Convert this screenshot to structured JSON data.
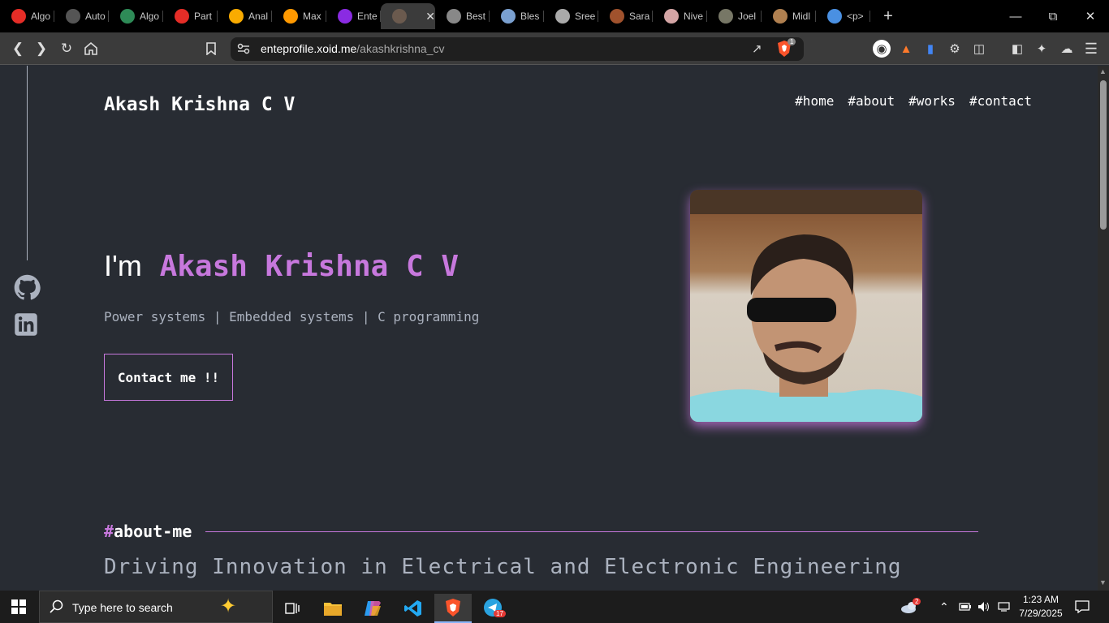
{
  "browser": {
    "tabs": [
      {
        "label": "Algo",
        "icon": "youtube-icon",
        "color": "#e52d27"
      },
      {
        "label": "Auto",
        "icon": "circle-logo-icon",
        "color": "#555555"
      },
      {
        "label": "Algo",
        "icon": "green-logo-icon",
        "color": "#2e8b57"
      },
      {
        "label": "Part",
        "icon": "youtube-icon",
        "color": "#e52d27"
      },
      {
        "label": "Anal",
        "icon": "analytics-icon",
        "color": "#f9ab00"
      },
      {
        "label": "Max",
        "icon": "amazon-icon",
        "color": "#ff9900"
      },
      {
        "label": "Ente",
        "icon": "ente-icon",
        "color": "#8a2be2"
      },
      {
        "label": "",
        "icon": "profile-photo-icon",
        "color": "#6b5a4e",
        "active": true
      },
      {
        "label": "Best",
        "icon": "photo-icon",
        "color": "#888888"
      },
      {
        "label": "Bles",
        "icon": "photo-icon",
        "color": "#7aa0d0"
      },
      {
        "label": "Sree",
        "icon": "photo-icon",
        "color": "#aaaaaa"
      },
      {
        "label": "Sara",
        "icon": "photo-icon",
        "color": "#a0522d"
      },
      {
        "label": "Nive",
        "icon": "photo-icon",
        "color": "#d4a5a5"
      },
      {
        "label": "Joel",
        "icon": "photo-icon",
        "color": "#777766"
      },
      {
        "label": "Midl",
        "icon": "photo-icon",
        "color": "#b08050"
      },
      {
        "label": "<p>",
        "icon": "colorful-icon",
        "color": "#4a90e2"
      }
    ],
    "url_domain": "enteprofile.xoid.me",
    "url_path": "/akashkrishna_cv",
    "shield_badge": "1"
  },
  "page": {
    "brand": "Akash Krishna C V",
    "nav": [
      "#home",
      "#about",
      "#works",
      "#contact"
    ],
    "hero_prefix": "I'm",
    "hero_name": "Akash Krishna C V",
    "subtitle": "Power systems | Embedded systems | C programming",
    "contact_button": "Contact me !!",
    "about_hash": "#",
    "about_heading": "about-me",
    "about_subtitle": "Driving Innovation in Electrical and Electronic Engineering",
    "accent_color": "#c778dd"
  },
  "taskbar": {
    "search_placeholder": "Type here to search",
    "time": "1:23 AM",
    "date": "7/29/2025",
    "weather_badge": "2",
    "telegram_badge": "17"
  }
}
